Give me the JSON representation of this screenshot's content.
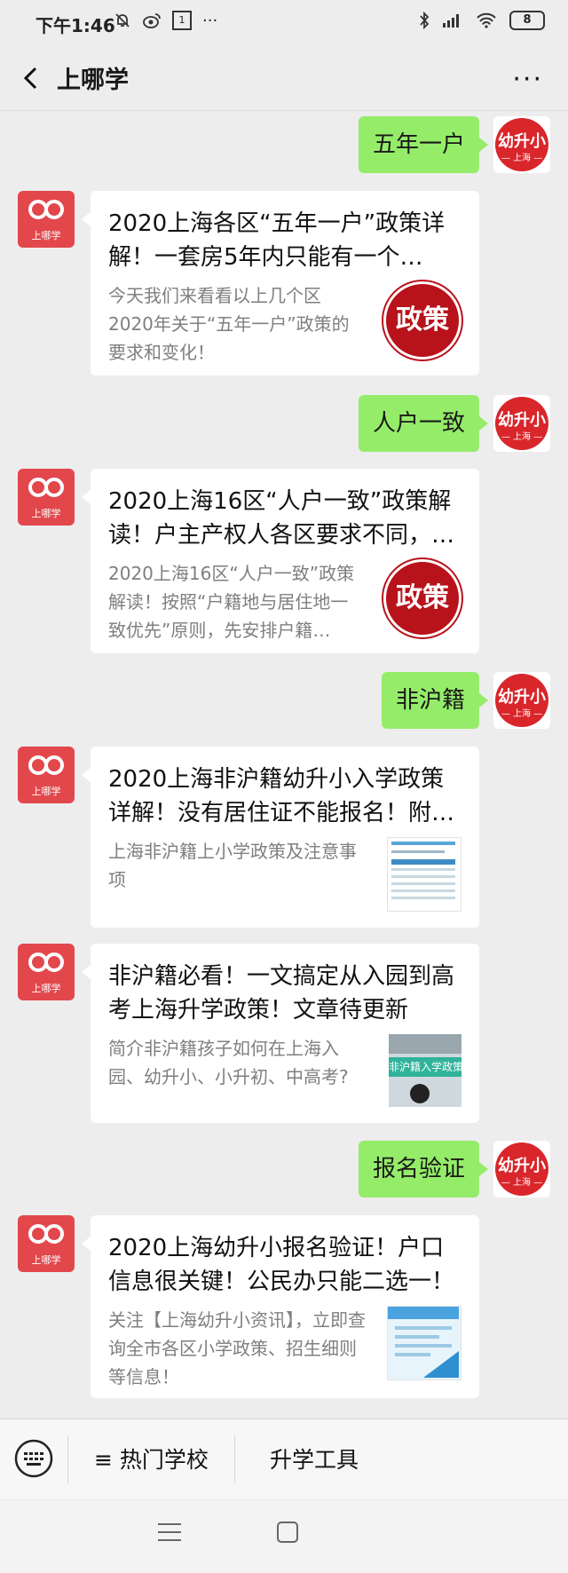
{
  "status_bar": {
    "time": "下午1:46",
    "calendar_day": "1",
    "battery": "8"
  },
  "header": {
    "title": "上哪学"
  },
  "avatars": {
    "bot_label": "上哪学",
    "user_line1": "幼升小",
    "user_line2": "— 上海 —"
  },
  "messages": [
    {
      "type": "user",
      "text": "五年一户"
    },
    {
      "type": "card",
      "title": "2020上海各区“五年一户”政策详解！一套房5年内只能有一个…",
      "desc": "今天我们来看看以上几个区2020年关于“五年一户”政策的要求和变化！",
      "thumb_text": "政策"
    },
    {
      "type": "user",
      "text": "人户一致"
    },
    {
      "type": "card",
      "title": "2020上海16区“人户一致”政策解读！户主产权人各区要求不同，…",
      "desc": "2020上海16区“人户一致”政策解读！按照“户籍地与居住地一致优先”原则，先安排户籍…",
      "thumb_text": "政策"
    },
    {
      "type": "user",
      "text": "非沪籍"
    },
    {
      "type": "card",
      "title": "2020上海非沪籍幼升小入学政策详解！没有居住证不能报名！附…",
      "desc": "上海非沪籍上小学政策及注意事项"
    },
    {
      "type": "card",
      "title": "非沪籍必看！一文搞定从入园到高考上海升学政策！文章待更新",
      "desc": "简介非沪籍孩子如何在上海入园、幼升小、小升初、中高考?",
      "thumb_text": "非沪籍入学政策解"
    },
    {
      "type": "user",
      "text": "报名验证"
    },
    {
      "type": "card",
      "title": "2020上海幼升小报名验证！户口信息很关键！公民办只能二选一！",
      "desc": "关注【上海幼升小资讯】，立即查询全市各区小学政策、招生细则等信息！"
    }
  ],
  "menu": {
    "item1": "≡ 热门学校",
    "item2": "升学工具"
  }
}
